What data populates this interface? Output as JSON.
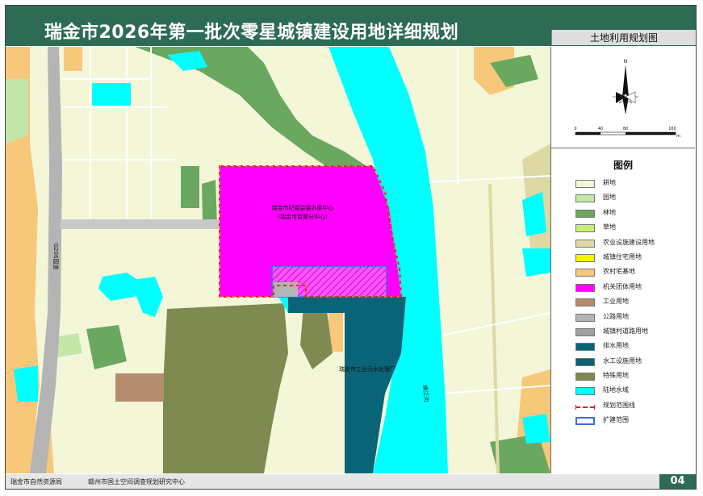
{
  "header": {
    "title": "瑞金市2026年第一批次零星城镇建设用地详细规划",
    "subtitle": "土地利用规划图"
  },
  "map": {
    "road_label": "G206国道",
    "site_label_1": "瑞金市纪委监委办案中心",
    "site_label_2": "(瑞金市留置分中心)",
    "plant_label": "瑞金市工业污水处理厂",
    "river_label": "绵江河"
  },
  "compass": {
    "north": "N",
    "scale_ticks": [
      "0",
      "40",
      "80",
      "160"
    ],
    "scale_unit": "m"
  },
  "legend": {
    "title": "图例",
    "items": [
      {
        "label": "耕地",
        "color": "#f4f6d8",
        "kind": "fill"
      },
      {
        "label": "园地",
        "color": "#c4e6a8",
        "kind": "fill"
      },
      {
        "label": "林地",
        "color": "#6aa860",
        "kind": "fill"
      },
      {
        "label": "草地",
        "color": "#c8ee78",
        "kind": "fill"
      },
      {
        "label": "农业设施建设用地",
        "color": "#ddd8a4",
        "kind": "fill"
      },
      {
        "label": "城镇住宅用地",
        "color": "#f5f500",
        "kind": "fill"
      },
      {
        "label": "农村宅基地",
        "color": "#f7c87a",
        "kind": "fill"
      },
      {
        "label": "机关团体用地",
        "color": "#ff00ff",
        "kind": "fill"
      },
      {
        "label": "工业用地",
        "color": "#b48c6e",
        "kind": "fill"
      },
      {
        "label": "公路用地",
        "color": "#b4b4b4",
        "kind": "fill"
      },
      {
        "label": "城镇村道路用地",
        "color": "#a0a0a0",
        "kind": "fill"
      },
      {
        "label": "排水用地",
        "color": "#0a6478",
        "kind": "fill"
      },
      {
        "label": "水工设施用地",
        "color": "#0a6478",
        "kind": "fill"
      },
      {
        "label": "特殊用地",
        "color": "#7e8a50",
        "kind": "fill"
      },
      {
        "label": "陆地水域",
        "color": "#00ffff",
        "kind": "fill"
      },
      {
        "label": "规划范围线",
        "color": "#e02020",
        "kind": "line"
      },
      {
        "label": "扩建范围",
        "color": "#3a6fd8",
        "kind": "outline"
      }
    ]
  },
  "footer": {
    "left": "瑞金市自然资源局",
    "middle": "赣州市国土空间调查规划研究中心",
    "page": "04"
  },
  "colors": {
    "header_bg": "#2e6b55",
    "farmland": "#f4f6d8",
    "water": "#00ffff",
    "institution": "#ff00ff",
    "drainage": "#0a6478",
    "special": "#7e8a50",
    "road": "#b4b4b4",
    "forest": "#6aa860",
    "rural": "#f7c87a"
  }
}
